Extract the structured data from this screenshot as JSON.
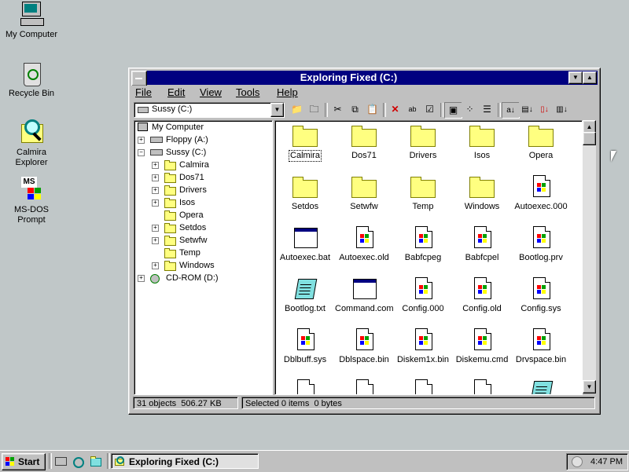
{
  "desktop": {
    "icons": [
      {
        "label": "My Computer"
      },
      {
        "label": "Recycle Bin"
      },
      {
        "label": "Calmira Explorer"
      },
      {
        "label": "MS-DOS Prompt"
      }
    ],
    "background_color": "#c0c7c8"
  },
  "window": {
    "title": "Exploring Fixed (C:)",
    "title_color": "#000080",
    "menu": [
      "File",
      "Edit",
      "View",
      "Tools",
      "Help"
    ],
    "drive_selector": "Sussy (C:)",
    "toolbar_icons": [
      "up-folder-icon",
      "new-folder-icon",
      "cut-icon",
      "copy-icon",
      "paste-icon",
      "delete-icon",
      "rename-icon",
      "properties-icon",
      "large-icons-icon",
      "small-icons-icon",
      "list-icon",
      "details-icon",
      "sort-name-icon",
      "sort-type-icon",
      "sort-size-icon",
      "sort-date-icon"
    ]
  },
  "tree": {
    "items": [
      {
        "label": "My Computer",
        "icon": "computer-icon"
      },
      {
        "label": "Floppy (A:)",
        "icon": "floppy-icon"
      },
      {
        "label": "Sussy (C:)",
        "icon": "hard-drive-icon"
      },
      {
        "label": "Calmira",
        "icon": "folder-icon"
      },
      {
        "label": "Dos71",
        "icon": "folder-icon"
      },
      {
        "label": "Drivers",
        "icon": "folder-icon"
      },
      {
        "label": "Isos",
        "icon": "folder-icon"
      },
      {
        "label": "Opera",
        "icon": "folder-icon"
      },
      {
        "label": "Setdos",
        "icon": "folder-icon"
      },
      {
        "label": "Setwfw",
        "icon": "folder-icon"
      },
      {
        "label": "Temp",
        "icon": "folder-icon"
      },
      {
        "label": "Windows",
        "icon": "folder-icon"
      },
      {
        "label": "CD-ROM (D:)",
        "icon": "cdrom-icon"
      }
    ]
  },
  "files": [
    {
      "name": "Calmira",
      "type": "folder"
    },
    {
      "name": "Dos71",
      "type": "folder"
    },
    {
      "name": "Drivers",
      "type": "folder"
    },
    {
      "name": "Isos",
      "type": "folder"
    },
    {
      "name": "Opera",
      "type": "folder"
    },
    {
      "name": "Setdos",
      "type": "folder"
    },
    {
      "name": "Setwfw",
      "type": "folder"
    },
    {
      "name": "Temp",
      "type": "folder"
    },
    {
      "name": "Windows",
      "type": "folder"
    },
    {
      "name": "Autoexec.000",
      "type": "doc"
    },
    {
      "name": "Autoexec.bat",
      "type": "app"
    },
    {
      "name": "Autoexec.old",
      "type": "doc"
    },
    {
      "name": "Babfcpeg",
      "type": "doc"
    },
    {
      "name": "Babfcpel",
      "type": "doc"
    },
    {
      "name": "Bootlog.prv",
      "type": "doc"
    },
    {
      "name": "Bootlog.txt",
      "type": "note"
    },
    {
      "name": "Command.com",
      "type": "app"
    },
    {
      "name": "Config.000",
      "type": "doc"
    },
    {
      "name": "Config.old",
      "type": "doc"
    },
    {
      "name": "Config.sys",
      "type": "doc"
    },
    {
      "name": "Dblbuff.sys",
      "type": "doc"
    },
    {
      "name": "Dblspace.bin",
      "type": "doc"
    },
    {
      "name": "Diskem1x.bin",
      "type": "doc"
    },
    {
      "name": "Diskemu.cmd",
      "type": "doc"
    },
    {
      "name": "Drvspace.bin",
      "type": "doc"
    }
  ],
  "status": {
    "objects": "31 objects",
    "size": "506.27 KB",
    "selected": "Selected 0 items",
    "selected_size": "0 bytes"
  },
  "taskbar": {
    "start": "Start",
    "task": "Exploring Fixed (C:)",
    "clock": "4:47 PM"
  }
}
